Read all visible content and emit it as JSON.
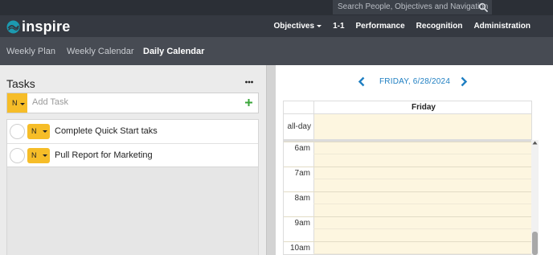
{
  "search": {
    "placeholder": "Search People, Objectives and Navigation"
  },
  "brand": {
    "name": "inspire"
  },
  "nav": {
    "items": [
      {
        "label": "Objectives",
        "has_dropdown": true
      },
      {
        "label": "1-1"
      },
      {
        "label": "Performance"
      },
      {
        "label": "Recognition"
      },
      {
        "label": "Administration"
      }
    ]
  },
  "subnav": {
    "tabs": [
      {
        "label": "Weekly Plan",
        "active": false
      },
      {
        "label": "Weekly Calendar",
        "active": false
      },
      {
        "label": "Daily Calendar",
        "active": true
      }
    ]
  },
  "tasks": {
    "title": "Tasks",
    "add_priority": "N",
    "add_placeholder": "Add Task",
    "items": [
      {
        "priority": "N",
        "name": "Complete Quick Start taks"
      },
      {
        "priority": "N",
        "name": "Pull Report for Marketing"
      }
    ]
  },
  "calendar": {
    "date_label": "FRIDAY, 6/28/2024",
    "day_header": "Friday",
    "allday_label": "all-day",
    "time_labels": [
      "6am",
      "7am",
      "8am",
      "9am",
      "10am"
    ]
  },
  "colors": {
    "accent": "#1f7fc2",
    "priority": "#f6bd28",
    "calendar_bg": "#fdf6e0",
    "add_icon": "#3aa63a"
  }
}
